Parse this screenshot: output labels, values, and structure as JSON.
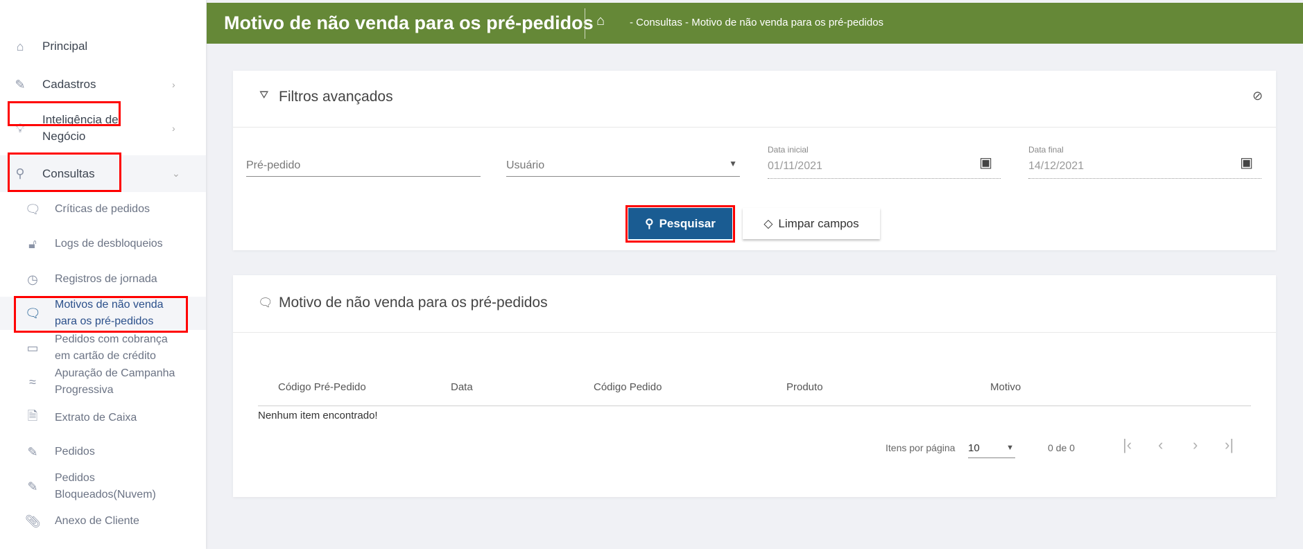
{
  "sidebar": {
    "items": [
      {
        "label": "Principal",
        "icon": "home-icon"
      },
      {
        "label": "Cadastros",
        "icon": "edit-icon"
      },
      {
        "label": "Inteligência de",
        "label2": "Negócio",
        "icon": "lightbulb-icon"
      },
      {
        "label": "Consultas",
        "icon": "search-icon"
      }
    ],
    "subitems": [
      {
        "label": "Críticas de pedidos",
        "icon": "chat-icon"
      },
      {
        "label": "Logs de desbloqueios",
        "icon": "unlock-icon"
      },
      {
        "label": "Registros de jornada",
        "icon": "clock-icon"
      },
      {
        "label": "Motivos de não venda",
        "label2": "para os pré-pedidos",
        "icon": "chat-icon"
      },
      {
        "label": "Pedidos com cobrança",
        "label2": "em cartão de crédito",
        "icon": "credit-card-icon"
      },
      {
        "label": "Apuração de Campanha",
        "label2": "Progressiva",
        "icon": "wave-icon"
      },
      {
        "label": "Extrato de Caixa",
        "icon": "document-icon"
      },
      {
        "label": "Pedidos",
        "icon": "edit-icon"
      },
      {
        "label": "Pedidos",
        "label2": "Bloqueados(Nuvem)",
        "icon": "edit-icon"
      },
      {
        "label": "Anexo de Cliente",
        "icon": "paperclip-icon"
      }
    ]
  },
  "header": {
    "title": "Motivo de não venda para os pré-pedidos",
    "breadcrumb": "- Consultas - Motivo de não venda para os pré-pedidos"
  },
  "filters": {
    "title": "Filtros avançados",
    "pre_pedido_placeholder": "Pré-pedido",
    "usuario_placeholder": "Usuário",
    "data_inicial_label": "Data inicial",
    "data_inicial": "01/11/2021",
    "data_final_label": "Data final",
    "data_final": "14/12/2021",
    "search_button": "Pesquisar",
    "clear_button": "Limpar campos"
  },
  "results": {
    "title": "Motivo de não venda para os pré-pedidos",
    "columns": [
      "Código Pré-Pedido",
      "Data",
      "Código Pedido",
      "Produto",
      "Motivo"
    ],
    "empty": "Nenhum item encontrado!",
    "items_per_page_label": "Itens por página",
    "items_per_page": "10",
    "range": "0 de 0"
  },
  "colors": {
    "header": "#658837",
    "primary": "#1a5c92",
    "highlight": "#ff0000"
  }
}
